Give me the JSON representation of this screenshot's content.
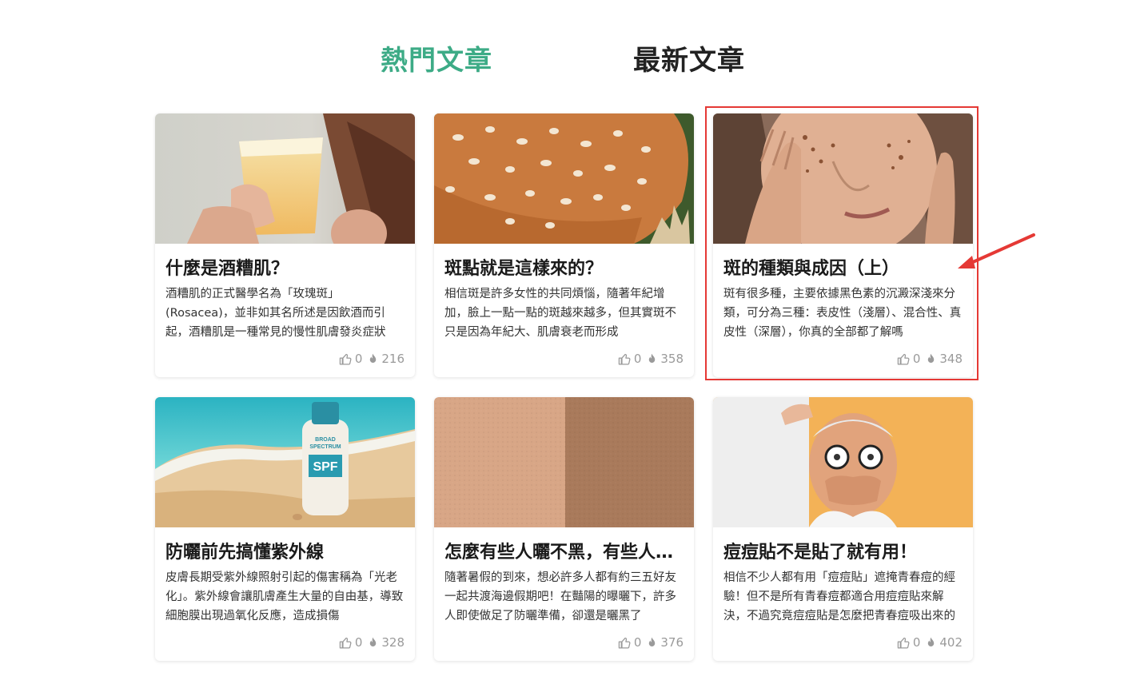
{
  "tabs": {
    "hot": "熱門文章",
    "latest": "最新文章"
  },
  "colors": {
    "accent": "#3dab86",
    "highlight": "#e53935",
    "stat_gray": "#9a9a9a"
  },
  "cards": [
    {
      "title": "什麼是酒糟肌？",
      "excerpt": "酒糟肌的正式醫學名為「玫瑰斑」(Rosacea)，並非如其名所述是因飲酒而引起，酒糟肌是一種常見的慢性肌膚發炎症狀",
      "likes": "0",
      "views": "216",
      "image": "woman-holding-beer-photo"
    },
    {
      "title": "斑點就是這樣來的？",
      "excerpt": "相信斑是許多女性的共同煩惱，隨著年紀增加，臉上一點一點的斑越來越多，但其實斑不只是因為年紀大、肌膚衰老而形成",
      "likes": "0",
      "views": "358",
      "image": "spotted-deer-photo"
    },
    {
      "title": "斑的種類與成因（上）",
      "excerpt": "斑有很多種，主要依據黑色素的沉澱深淺來分類，可分為三種：表皮性（淺層）、混合性、真皮性（深層），你真的全部都了解嗎",
      "likes": "0",
      "views": "348",
      "image": "woman-face-spots-photo"
    },
    {
      "title": "防曬前先搞懂紫外線",
      "excerpt": "皮膚長期受紫外線照射引起的傷害稱為「光老化」。紫外線會讓肌膚產生大量的自由基，導致細胞膜出現過氧化反應，造成損傷",
      "likes": "0",
      "views": "328",
      "image": "sunscreen-on-beach-photo",
      "bottle_text": [
        "BROAD",
        "SPECTRUM",
        "SPF"
      ]
    },
    {
      "title": "怎麼有些人曬不黑，有些人曬了就黑",
      "excerpt": "隨著暑假的到來，想必許多人都有約三五好友一起共渡海邊假期吧！在豔陽的曝曬下，許多人即使做足了防曬準備，卻還是曬黑了",
      "likes": "0",
      "views": "376",
      "image": "skin-tone-texture-photo"
    },
    {
      "title": "痘痘貼不是貼了就有用！",
      "excerpt": "相信不少人都有用「痘痘貼」遮掩青春痘的經驗！但不是所有青春痘都適合用痘痘貼來解決，不過究竟痘痘貼是怎麼把青春痘吸出來的",
      "likes": "0",
      "views": "402",
      "image": "surprised-old-man-photo"
    }
  ]
}
